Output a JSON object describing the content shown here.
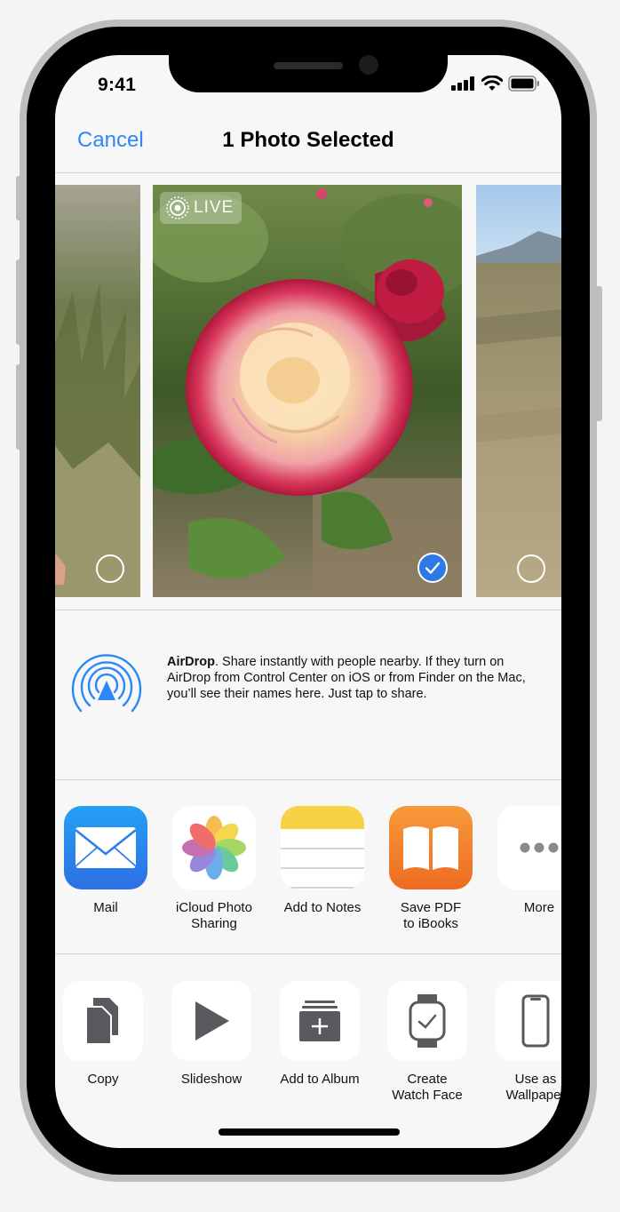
{
  "status_bar": {
    "time": "9:41"
  },
  "nav": {
    "cancel_label": "Cancel",
    "title": "1 Photo Selected"
  },
  "photos": {
    "live_label": "LIVE",
    "items": [
      {
        "name": "left-photo",
        "selected": false
      },
      {
        "name": "rose-photo",
        "selected": true
      },
      {
        "name": "landscape-photo",
        "selected": false
      }
    ]
  },
  "airdrop": {
    "title": "AirDrop",
    "description": ". Share instantly with people nearby. If they turn on AirDrop from Control Center on iOS or from Finder on the Mac, you’ll see their names here. Just tap to share."
  },
  "share_apps": [
    {
      "label": "Mail",
      "icon": "mail-icon"
    },
    {
      "label": "iCloud Photo\nSharing",
      "icon": "photos-icon"
    },
    {
      "label": "Add to Notes",
      "icon": "notes-icon"
    },
    {
      "label": "Save PDF\nto iBooks",
      "icon": "ibooks-icon"
    },
    {
      "label": "More",
      "icon": "more-icon"
    }
  ],
  "actions": [
    {
      "label": "Copy",
      "icon": "copy-icon"
    },
    {
      "label": "Slideshow",
      "icon": "play-icon"
    },
    {
      "label": "Add to Album",
      "icon": "add-album-icon"
    },
    {
      "label": "Create\nWatch Face",
      "icon": "watch-icon"
    },
    {
      "label": "Use as\nWallpaper",
      "icon": "phone-icon"
    }
  ],
  "colors": {
    "accent": "#2e87f6",
    "selection": "#2e79e6"
  }
}
